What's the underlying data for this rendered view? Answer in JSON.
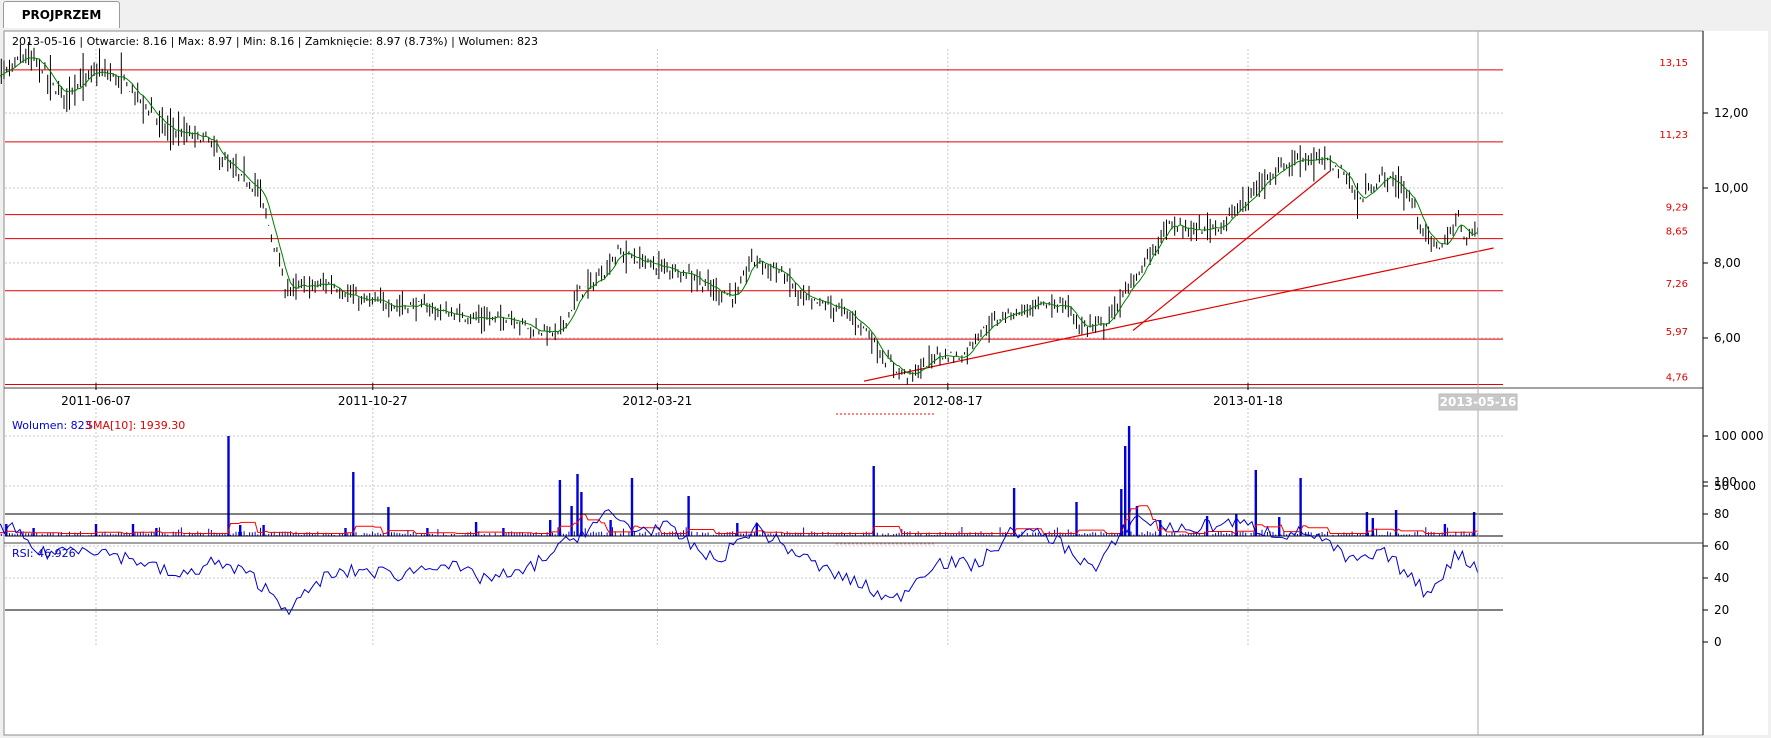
{
  "tab": {
    "label": "PROJPRZEM"
  },
  "header": {
    "info": "2013-05-16 | Otwarcie: 8.16 | Max: 8.97 | Min: 8.16 | Zamknięcie: 8.97 (8.73%) | Wolumen: 823"
  },
  "volume_legend": {
    "volume": "Wolumen: 823",
    "sma": "SMA[10]: 1939.30"
  },
  "rsi_legend": "RSI: 46.926",
  "cursor_date": "2013-05-16",
  "colors": {
    "price_bar": "#000000",
    "ma_line": "#008000",
    "level_line": "#e00000",
    "volume_bar": "#0000dd",
    "sma_line": "#ff0000",
    "rsi_line": "#0000cc",
    "cursor_bg": "#c8c8c8"
  },
  "chart_data": [
    {
      "type": "ohlc",
      "x_ticks": [
        "2011-06-07",
        "2011-10-27",
        "2012-03-21",
        "2012-08-17",
        "2013-01-18"
      ],
      "y_ticks": [
        "6,00",
        "8,00",
        "10,00",
        "12,00"
      ],
      "ylim": [
        4.7,
        13.9
      ],
      "levels": [
        "13,15",
        "11,23",
        "9,29",
        "8,65",
        "7,26",
        "5,97",
        "4,76"
      ],
      "trendlines": [
        {
          "from": [
            "2012-07-05",
            4.85
          ],
          "to": [
            "2013-05-24",
            8.4
          ]
        },
        {
          "from": [
            "2012-11-20",
            6.2
          ],
          "to": [
            "2013-03-01",
            10.45
          ]
        }
      ],
      "close_path": [
        [
          "2011-04-11",
          12.8
        ],
        [
          "2011-04-20",
          13.0
        ],
        [
          "2011-05-01",
          13.5
        ],
        [
          "2011-05-09",
          13.3
        ],
        [
          "2011-05-19",
          12.5
        ],
        [
          "2011-05-30",
          12.8
        ],
        [
          "2011-06-07",
          13.1
        ],
        [
          "2011-06-20",
          12.9
        ],
        [
          "2011-07-01",
          12.3
        ],
        [
          "2011-07-12",
          11.6
        ],
        [
          "2011-07-25",
          11.4
        ],
        [
          "2011-08-03",
          11.3
        ],
        [
          "2011-08-10",
          10.8
        ],
        [
          "2011-08-19",
          10.3
        ],
        [
          "2011-08-29",
          10.0
        ],
        [
          "2011-09-02",
          9.3
        ],
        [
          "2011-09-08",
          8.2
        ],
        [
          "2011-09-12",
          7.3
        ],
        [
          "2011-09-21",
          7.35
        ],
        [
          "2011-10-05",
          7.45
        ],
        [
          "2011-10-20",
          7.0
        ],
        [
          "2011-11-06",
          6.9
        ],
        [
          "2011-11-20",
          6.85
        ],
        [
          "2011-12-10",
          6.6
        ],
        [
          "2011-12-30",
          6.5
        ],
        [
          "2012-01-05",
          6.6
        ],
        [
          "2012-01-16",
          6.25
        ],
        [
          "2012-01-30",
          6.1
        ],
        [
          "2012-02-10",
          7.2
        ],
        [
          "2012-02-20",
          7.6
        ],
        [
          "2012-03-01",
          8.3
        ],
        [
          "2012-03-08",
          8.15
        ],
        [
          "2012-03-21",
          7.9
        ],
        [
          "2012-04-06",
          7.75
        ],
        [
          "2012-04-18",
          7.3
        ],
        [
          "2012-05-01",
          7.1
        ],
        [
          "2012-05-08",
          8.1
        ],
        [
          "2012-05-22",
          7.8
        ],
        [
          "2012-06-05",
          7.0
        ],
        [
          "2012-06-20",
          6.85
        ],
        [
          "2012-07-05",
          6.3
        ],
        [
          "2012-07-16",
          5.4
        ],
        [
          "2012-07-28",
          4.95
        ],
        [
          "2012-08-03",
          5.2
        ],
        [
          "2012-08-11",
          5.55
        ],
        [
          "2012-08-25",
          5.5
        ],
        [
          "2012-09-01",
          6.1
        ],
        [
          "2012-09-15",
          6.6
        ],
        [
          "2012-10-01",
          6.85
        ],
        [
          "2012-10-16",
          6.9
        ],
        [
          "2012-10-24",
          6.3
        ],
        [
          "2012-11-05",
          6.35
        ],
        [
          "2012-11-20",
          7.5
        ],
        [
          "2012-11-30",
          8.35
        ],
        [
          "2012-12-08",
          9.0
        ],
        [
          "2012-12-24",
          8.85
        ],
        [
          "2013-01-05",
          9.05
        ],
        [
          "2013-01-18",
          9.7
        ],
        [
          "2013-01-30",
          10.4
        ],
        [
          "2013-02-13",
          10.8
        ],
        [
          "2013-02-28",
          10.7
        ],
        [
          "2013-03-10",
          10.3
        ],
        [
          "2013-03-15",
          9.6
        ],
        [
          "2013-03-28",
          10.3
        ],
        [
          "2013-04-05",
          10.1
        ],
        [
          "2013-04-12",
          9.65
        ],
        [
          "2013-04-20",
          8.6
        ],
        [
          "2013-04-28",
          8.45
        ],
        [
          "2013-05-06",
          9.2
        ],
        [
          "2013-05-10",
          8.6
        ],
        [
          "2013-05-16",
          8.97
        ]
      ]
    },
    {
      "type": "bar",
      "name": "Wolumen",
      "y_ticks": [
        "50 000",
        "100 000"
      ],
      "ylim": [
        0,
        110000
      ],
      "spikes": [
        [
          "2011-04-13",
          9000
        ],
        [
          "2011-04-22",
          12000
        ],
        [
          "2011-05-06",
          8000
        ],
        [
          "2011-06-07",
          12000
        ],
        [
          "2011-06-26",
          12000
        ],
        [
          "2011-07-08",
          8000
        ],
        [
          "2011-08-14",
          100000
        ],
        [
          "2011-08-20",
          11000
        ],
        [
          "2011-09-01",
          11000
        ],
        [
          "2011-10-13",
          8000
        ],
        [
          "2011-10-17",
          64000
        ],
        [
          "2011-11-04",
          29000
        ],
        [
          "2011-11-24",
          8000
        ],
        [
          "2011-12-19",
          14000
        ],
        [
          "2012-01-02",
          8000
        ],
        [
          "2012-01-26",
          16000
        ],
        [
          "2012-01-31",
          56000
        ],
        [
          "2012-02-06",
          30000
        ],
        [
          "2012-02-09",
          62000
        ],
        [
          "2012-02-11",
          44000
        ],
        [
          "2012-02-26",
          16000
        ],
        [
          "2012-03-08",
          58000
        ],
        [
          "2012-04-06",
          40000
        ],
        [
          "2012-05-01",
          13000
        ],
        [
          "2012-05-11",
          13000
        ],
        [
          "2012-07-10",
          70000
        ],
        [
          "2012-09-20",
          48000
        ],
        [
          "2012-10-22",
          34000
        ],
        [
          "2012-11-14",
          47000
        ],
        [
          "2012-11-16",
          90000
        ],
        [
          "2012-11-18",
          110000
        ],
        [
          "2012-11-22",
          30000
        ],
        [
          "2012-12-04",
          16000
        ],
        [
          "2012-12-28",
          20000
        ],
        [
          "2013-01-12",
          22000
        ],
        [
          "2013-01-22",
          66000
        ],
        [
          "2013-02-03",
          19000
        ],
        [
          "2013-02-14",
          58000
        ],
        [
          "2013-03-20",
          24000
        ],
        [
          "2013-03-23",
          18000
        ],
        [
          "2013-04-04",
          26000
        ],
        [
          "2013-04-29",
          12000
        ],
        [
          "2013-05-14",
          24000
        ]
      ]
    },
    {
      "type": "line",
      "name": "RSI",
      "y_ticks": [
        "0",
        "20",
        "40",
        "60",
        "80",
        "100"
      ],
      "ylim": [
        0,
        100
      ],
      "levels": [
        20,
        80
      ],
      "path": [
        [
          "2011-04-11",
          70
        ],
        [
          "2011-04-25",
          70
        ],
        [
          "2011-05-10",
          55
        ],
        [
          "2011-06-01",
          60
        ],
        [
          "2011-06-15",
          55
        ],
        [
          "2011-07-01",
          50
        ],
        [
          "2011-07-20",
          40
        ],
        [
          "2011-08-05",
          50
        ],
        [
          "2011-08-25",
          42
        ],
        [
          "2011-09-07",
          28
        ],
        [
          "2011-09-15",
          20
        ],
        [
          "2011-10-01",
          40
        ],
        [
          "2011-10-20",
          45
        ],
        [
          "2011-11-10",
          42
        ],
        [
          "2011-12-01",
          50
        ],
        [
          "2011-12-20",
          40
        ],
        [
          "2012-01-10",
          42
        ],
        [
          "2012-02-01",
          60
        ],
        [
          "2012-02-25",
          80
        ],
        [
          "2012-03-10",
          70
        ],
        [
          "2012-03-25",
          72
        ],
        [
          "2012-04-20",
          50
        ],
        [
          "2012-05-10",
          72
        ],
        [
          "2012-05-25",
          60
        ],
        [
          "2012-06-15",
          45
        ],
        [
          "2012-07-05",
          35
        ],
        [
          "2012-07-20",
          25
        ],
        [
          "2012-08-10",
          50
        ],
        [
          "2012-09-01",
          48
        ],
        [
          "2012-09-20",
          70
        ],
        [
          "2012-10-10",
          65
        ],
        [
          "2012-11-01",
          45
        ],
        [
          "2012-11-20",
          78
        ],
        [
          "2012-12-15",
          70
        ],
        [
          "2013-01-10",
          75
        ],
        [
          "2013-02-01",
          68
        ],
        [
          "2013-02-20",
          68
        ],
        [
          "2013-03-12",
          50
        ],
        [
          "2013-03-30",
          55
        ],
        [
          "2013-04-20",
          30
        ],
        [
          "2013-05-05",
          55
        ],
        [
          "2013-05-16",
          47
        ]
      ]
    }
  ]
}
